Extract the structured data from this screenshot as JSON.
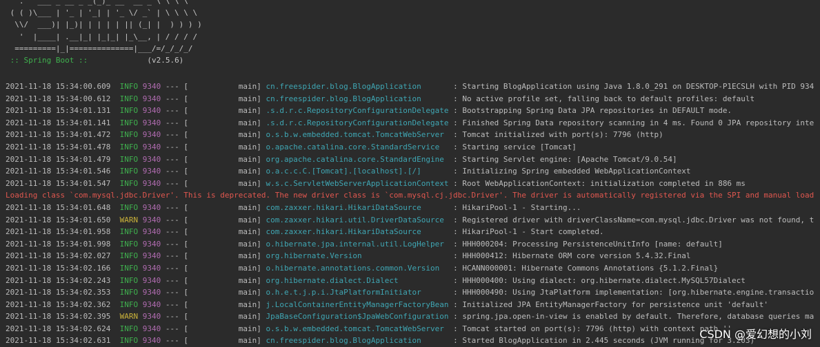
{
  "banner": {
    "art_lines": [
      "  '.   ___ _ __ _ _(_)_ __  __ _ \\ \\ \\ \\",
      " ( ( )\\___ | '_ | '_| | '_ \\/ _` | \\ \\ \\ \\",
      "  \\\\/  ___)| |_)| | | | | || (_| |  ) ) ) )",
      "   '  |____| .__|_| |_|_| |_\\__, | / / / /",
      "  =========|_|==============|___/=/_/_/_/"
    ],
    "spring_boot_label": " :: Spring Boot :: ",
    "version": "(v2.5.6)"
  },
  "log_rows": [
    {
      "ts": "2021-11-18 15:34:00.609",
      "level": "INFO",
      "pid": "9340",
      "thread": "main",
      "logger": "cn.freespider.blog.BlogApplication",
      "msg": "Starting BlogApplication using Java 1.8.0_291 on DESKTOP-P1ECSLH with PID 934"
    },
    {
      "ts": "2021-11-18 15:34:00.612",
      "level": "INFO",
      "pid": "9340",
      "thread": "main",
      "logger": "cn.freespider.blog.BlogApplication",
      "msg": "No active profile set, falling back to default profiles: default"
    },
    {
      "ts": "2021-11-18 15:34:01.131",
      "level": "INFO",
      "pid": "9340",
      "thread": "main",
      "logger": ".s.d.r.c.RepositoryConfigurationDelegate",
      "msg": "Bootstrapping Spring Data JPA repositories in DEFAULT mode."
    },
    {
      "ts": "2021-11-18 15:34:01.141",
      "level": "INFO",
      "pid": "9340",
      "thread": "main",
      "logger": ".s.d.r.c.RepositoryConfigurationDelegate",
      "msg": "Finished Spring Data repository scanning in 4 ms. Found 0 JPA repository inte"
    },
    {
      "ts": "2021-11-18 15:34:01.472",
      "level": "INFO",
      "pid": "9340",
      "thread": "main",
      "logger": "o.s.b.w.embedded.tomcat.TomcatWebServer",
      "msg": "Tomcat initialized with port(s): 7796 (http)"
    },
    {
      "ts": "2021-11-18 15:34:01.478",
      "level": "INFO",
      "pid": "9340",
      "thread": "main",
      "logger": "o.apache.catalina.core.StandardService",
      "msg": "Starting service [Tomcat]"
    },
    {
      "ts": "2021-11-18 15:34:01.479",
      "level": "INFO",
      "pid": "9340",
      "thread": "main",
      "logger": "org.apache.catalina.core.StandardEngine",
      "msg": "Starting Servlet engine: [Apache Tomcat/9.0.54]"
    },
    {
      "ts": "2021-11-18 15:34:01.546",
      "level": "INFO",
      "pid": "9340",
      "thread": "main",
      "logger": "o.a.c.c.C.[Tomcat].[localhost].[/]",
      "msg": "Initializing Spring embedded WebApplicationContext"
    },
    {
      "ts": "2021-11-18 15:34:01.547",
      "level": "INFO",
      "pid": "9340",
      "thread": "main",
      "logger": "w.s.c.ServletWebServerApplicationContext",
      "msg": "Root WebApplicationContext: initialization completed in 886 ms"
    },
    {
      "error": "Loading class `com.mysql.jdbc.Driver'. This is deprecated. The new driver class is `com.mysql.cj.jdbc.Driver'. The driver is automatically registered via the SPI and manual load"
    },
    {
      "ts": "2021-11-18 15:34:01.648",
      "level": "INFO",
      "pid": "9340",
      "thread": "main",
      "logger": "com.zaxxer.hikari.HikariDataSource",
      "msg": "HikariPool-1 - Starting..."
    },
    {
      "ts": "2021-11-18 15:34:01.650",
      "level": "WARN",
      "pid": "9340",
      "thread": "main",
      "logger": "com.zaxxer.hikari.util.DriverDataSource",
      "msg": "Registered driver with driverClassName=com.mysql.jdbc.Driver was not found, t"
    },
    {
      "ts": "2021-11-18 15:34:01.958",
      "level": "INFO",
      "pid": "9340",
      "thread": "main",
      "logger": "com.zaxxer.hikari.HikariDataSource",
      "msg": "HikariPool-1 - Start completed."
    },
    {
      "ts": "2021-11-18 15:34:01.998",
      "level": "INFO",
      "pid": "9340",
      "thread": "main",
      "logger": "o.hibernate.jpa.internal.util.LogHelper",
      "msg": "HHH000204: Processing PersistenceUnitInfo [name: default]"
    },
    {
      "ts": "2021-11-18 15:34:02.027",
      "level": "INFO",
      "pid": "9340",
      "thread": "main",
      "logger": "org.hibernate.Version",
      "msg": "HHH000412: Hibernate ORM core version 5.4.32.Final"
    },
    {
      "ts": "2021-11-18 15:34:02.166",
      "level": "INFO",
      "pid": "9340",
      "thread": "main",
      "logger": "o.hibernate.annotations.common.Version",
      "msg": "HCANN000001: Hibernate Commons Annotations {5.1.2.Final}"
    },
    {
      "ts": "2021-11-18 15:34:02.243",
      "level": "INFO",
      "pid": "9340",
      "thread": "main",
      "logger": "org.hibernate.dialect.Dialect",
      "msg": "HHH000400: Using dialect: org.hibernate.dialect.MySQL57Dialect"
    },
    {
      "ts": "2021-11-18 15:34:02.353",
      "level": "INFO",
      "pid": "9340",
      "thread": "main",
      "logger": "o.h.e.t.j.p.i.JtaPlatformInitiator",
      "msg": "HHH000490: Using JtaPlatform implementation: [org.hibernate.engine.transactio"
    },
    {
      "ts": "2021-11-18 15:34:02.362",
      "level": "INFO",
      "pid": "9340",
      "thread": "main",
      "logger": "j.LocalContainerEntityManagerFactoryBean",
      "msg": "Initialized JPA EntityManagerFactory for persistence unit 'default'"
    },
    {
      "ts": "2021-11-18 15:34:02.395",
      "level": "WARN",
      "pid": "9340",
      "thread": "main",
      "logger": "JpaBaseConfiguration$JpaWebConfiguration",
      "msg": "spring.jpa.open-in-view is enabled by default. Therefore, database queries ma"
    },
    {
      "ts": "2021-11-18 15:34:02.624",
      "level": "INFO",
      "pid": "9340",
      "thread": "main",
      "logger": "o.s.b.w.embedded.tomcat.TomcatWebServer",
      "msg": "Tomcat started on port(s): 7796 (http) with context path ''"
    },
    {
      "ts": "2021-11-18 15:34:02.631",
      "level": "INFO",
      "pid": "9340",
      "thread": "main",
      "logger": "cn.freespider.blog.BlogApplication",
      "msg": "Started BlogApplication in 2.445 seconds (JVM running for 3.203)"
    }
  ],
  "watermark": "CSDN @爱幻想的小刘",
  "colors": {
    "background": "#2b2b2b",
    "info": "#3fb14e",
    "warn": "#c9b13a",
    "pid": "#b06cb0",
    "logger": "#3fa6b3",
    "error": "#e0574f"
  }
}
